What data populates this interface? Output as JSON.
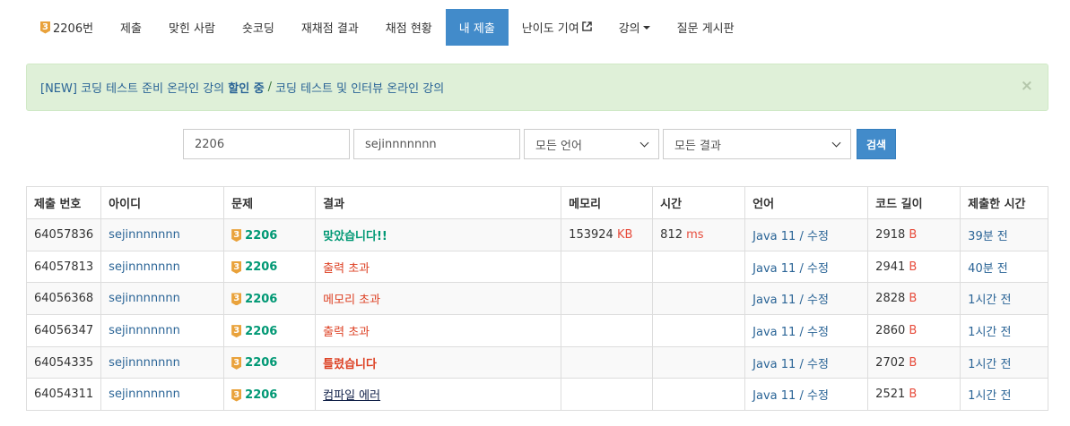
{
  "nav": {
    "problem_tier": "3",
    "problem_label": "2206번",
    "items": [
      "제출",
      "맞힌 사람",
      "숏코딩",
      "재채점 결과",
      "채점 현황"
    ],
    "active": "내 제출",
    "difficulty": "난이도 기여",
    "lecture": "강의",
    "board": "질문 게시판"
  },
  "alert": {
    "prefix": "[NEW] 코딩 테스트 준비 온라인 강의 ",
    "highlight": "할인 중",
    "sep": "/",
    "second": "코딩 테스트 및 인터뷰 온라인 강의",
    "close": "×"
  },
  "search": {
    "problem": "2206",
    "user": "sejinnnnnnn",
    "language": "모든 언어",
    "result": "모든 결과",
    "button": "검색"
  },
  "table": {
    "headers": [
      "제출 번호",
      "아이디",
      "문제",
      "결과",
      "메모리",
      "시간",
      "언어",
      "코드 길이",
      "제출한 시간"
    ],
    "rows": [
      {
        "id": "64057836",
        "user": "sejinnnnnnn",
        "tier": "3",
        "problem": "2206",
        "result": "맞았습니다!!",
        "memory": "153924",
        "memory_unit": "KB",
        "time": "812",
        "time_unit": "ms",
        "lang": "Java 11",
        "edit": "수정",
        "length": "2918",
        "length_unit": "B",
        "when": "39분 전"
      },
      {
        "id": "64057813",
        "user": "sejinnnnnnn",
        "tier": "3",
        "problem": "2206",
        "result": "출력 초과",
        "memory": "",
        "memory_unit": "",
        "time": "",
        "time_unit": "",
        "lang": "Java 11",
        "edit": "수정",
        "length": "2941",
        "length_unit": "B",
        "when": "40분 전"
      },
      {
        "id": "64056368",
        "user": "sejinnnnnnn",
        "tier": "3",
        "problem": "2206",
        "result": "메모리 초과",
        "memory": "",
        "memory_unit": "",
        "time": "",
        "time_unit": "",
        "lang": "Java 11",
        "edit": "수정",
        "length": "2828",
        "length_unit": "B",
        "when": "1시간 전"
      },
      {
        "id": "64056347",
        "user": "sejinnnnnnn",
        "tier": "3",
        "problem": "2206",
        "result": "출력 초과",
        "memory": "",
        "memory_unit": "",
        "time": "",
        "time_unit": "",
        "lang": "Java 11",
        "edit": "수정",
        "length": "2860",
        "length_unit": "B",
        "when": "1시간 전"
      },
      {
        "id": "64054335",
        "user": "sejinnnnnnn",
        "tier": "3",
        "problem": "2206",
        "result": "틀렸습니다",
        "memory": "",
        "memory_unit": "",
        "time": "",
        "time_unit": "",
        "lang": "Java 11",
        "edit": "수정",
        "length": "2702",
        "length_unit": "B",
        "when": "1시간 전"
      },
      {
        "id": "64054311",
        "user": "sejinnnnnnn",
        "tier": "3",
        "problem": "2206",
        "result": "컴파일 에러",
        "memory": "",
        "memory_unit": "",
        "time": "",
        "time_unit": "",
        "lang": "Java 11",
        "edit": "수정",
        "length": "2521",
        "length_unit": "B",
        "when": "1시간 전"
      }
    ]
  },
  "colors": {
    "primary": "#428bca",
    "accepted": "#009874",
    "error": "#dd4124",
    "alert_bg": "#dff0d8"
  }
}
